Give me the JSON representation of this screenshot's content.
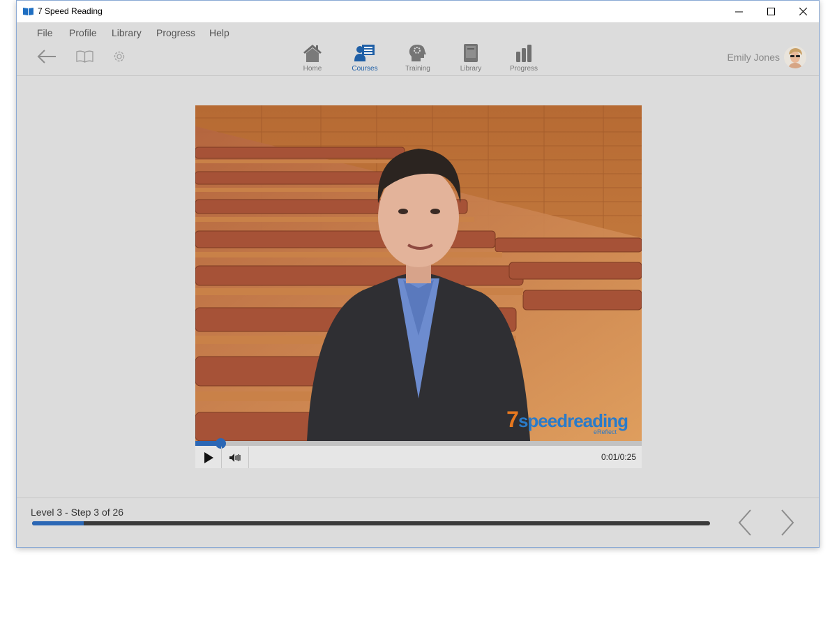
{
  "window": {
    "title": "7 Speed Reading"
  },
  "menu": [
    "File",
    "Profile",
    "Library",
    "Progress",
    "Help"
  ],
  "toolbar": {
    "nav": [
      {
        "label": "Home",
        "icon": "home-icon",
        "active": false
      },
      {
        "label": "Courses",
        "icon": "courses-icon",
        "active": true
      },
      {
        "label": "Training",
        "icon": "training-icon",
        "active": false
      },
      {
        "label": "Library",
        "icon": "library-icon",
        "active": false
      },
      {
        "label": "Progress",
        "icon": "progress-icon",
        "active": false
      }
    ],
    "user": "Emily Jones"
  },
  "video": {
    "logo_number": "7",
    "logo_text": "speedreading",
    "logo_sub": "eReflect",
    "time": "0:01/0:25",
    "progress": 0.056
  },
  "footer": {
    "step": "Level 3 - Step 3 of 26",
    "progress": 0.0765
  },
  "colors": {
    "accent": "#2b67b5",
    "orange": "#e8781e"
  }
}
